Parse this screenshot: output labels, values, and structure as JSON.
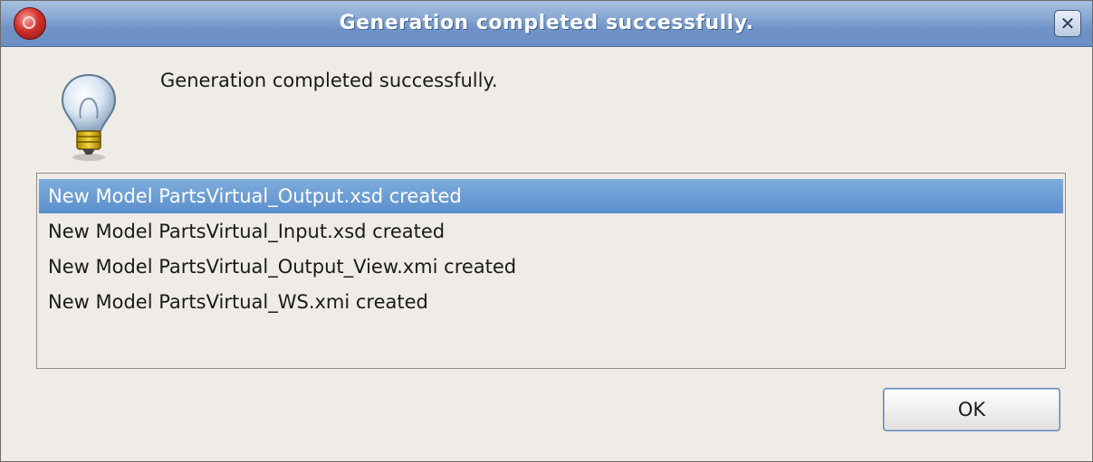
{
  "window": {
    "title": "Generation completed successfully.",
    "close_glyph": "✕",
    "app_icon": "app-logo-icon"
  },
  "dialog": {
    "icon": "lightbulb-info-icon",
    "message": "Generation completed successfully."
  },
  "list": {
    "items": [
      {
        "label": "New Model PartsVirtual_Output.xsd created",
        "selected": true
      },
      {
        "label": "New Model PartsVirtual_Input.xsd created",
        "selected": false
      },
      {
        "label": "New Model PartsVirtual_Output_View.xmi created",
        "selected": false
      },
      {
        "label": "New Model PartsVirtual_WS.xmi created",
        "selected": false
      }
    ]
  },
  "buttons": {
    "ok_label": "OK"
  },
  "colors": {
    "title_bar": "#7a9ccc",
    "selection": "#6d9ed5",
    "background": "#efebe7"
  }
}
